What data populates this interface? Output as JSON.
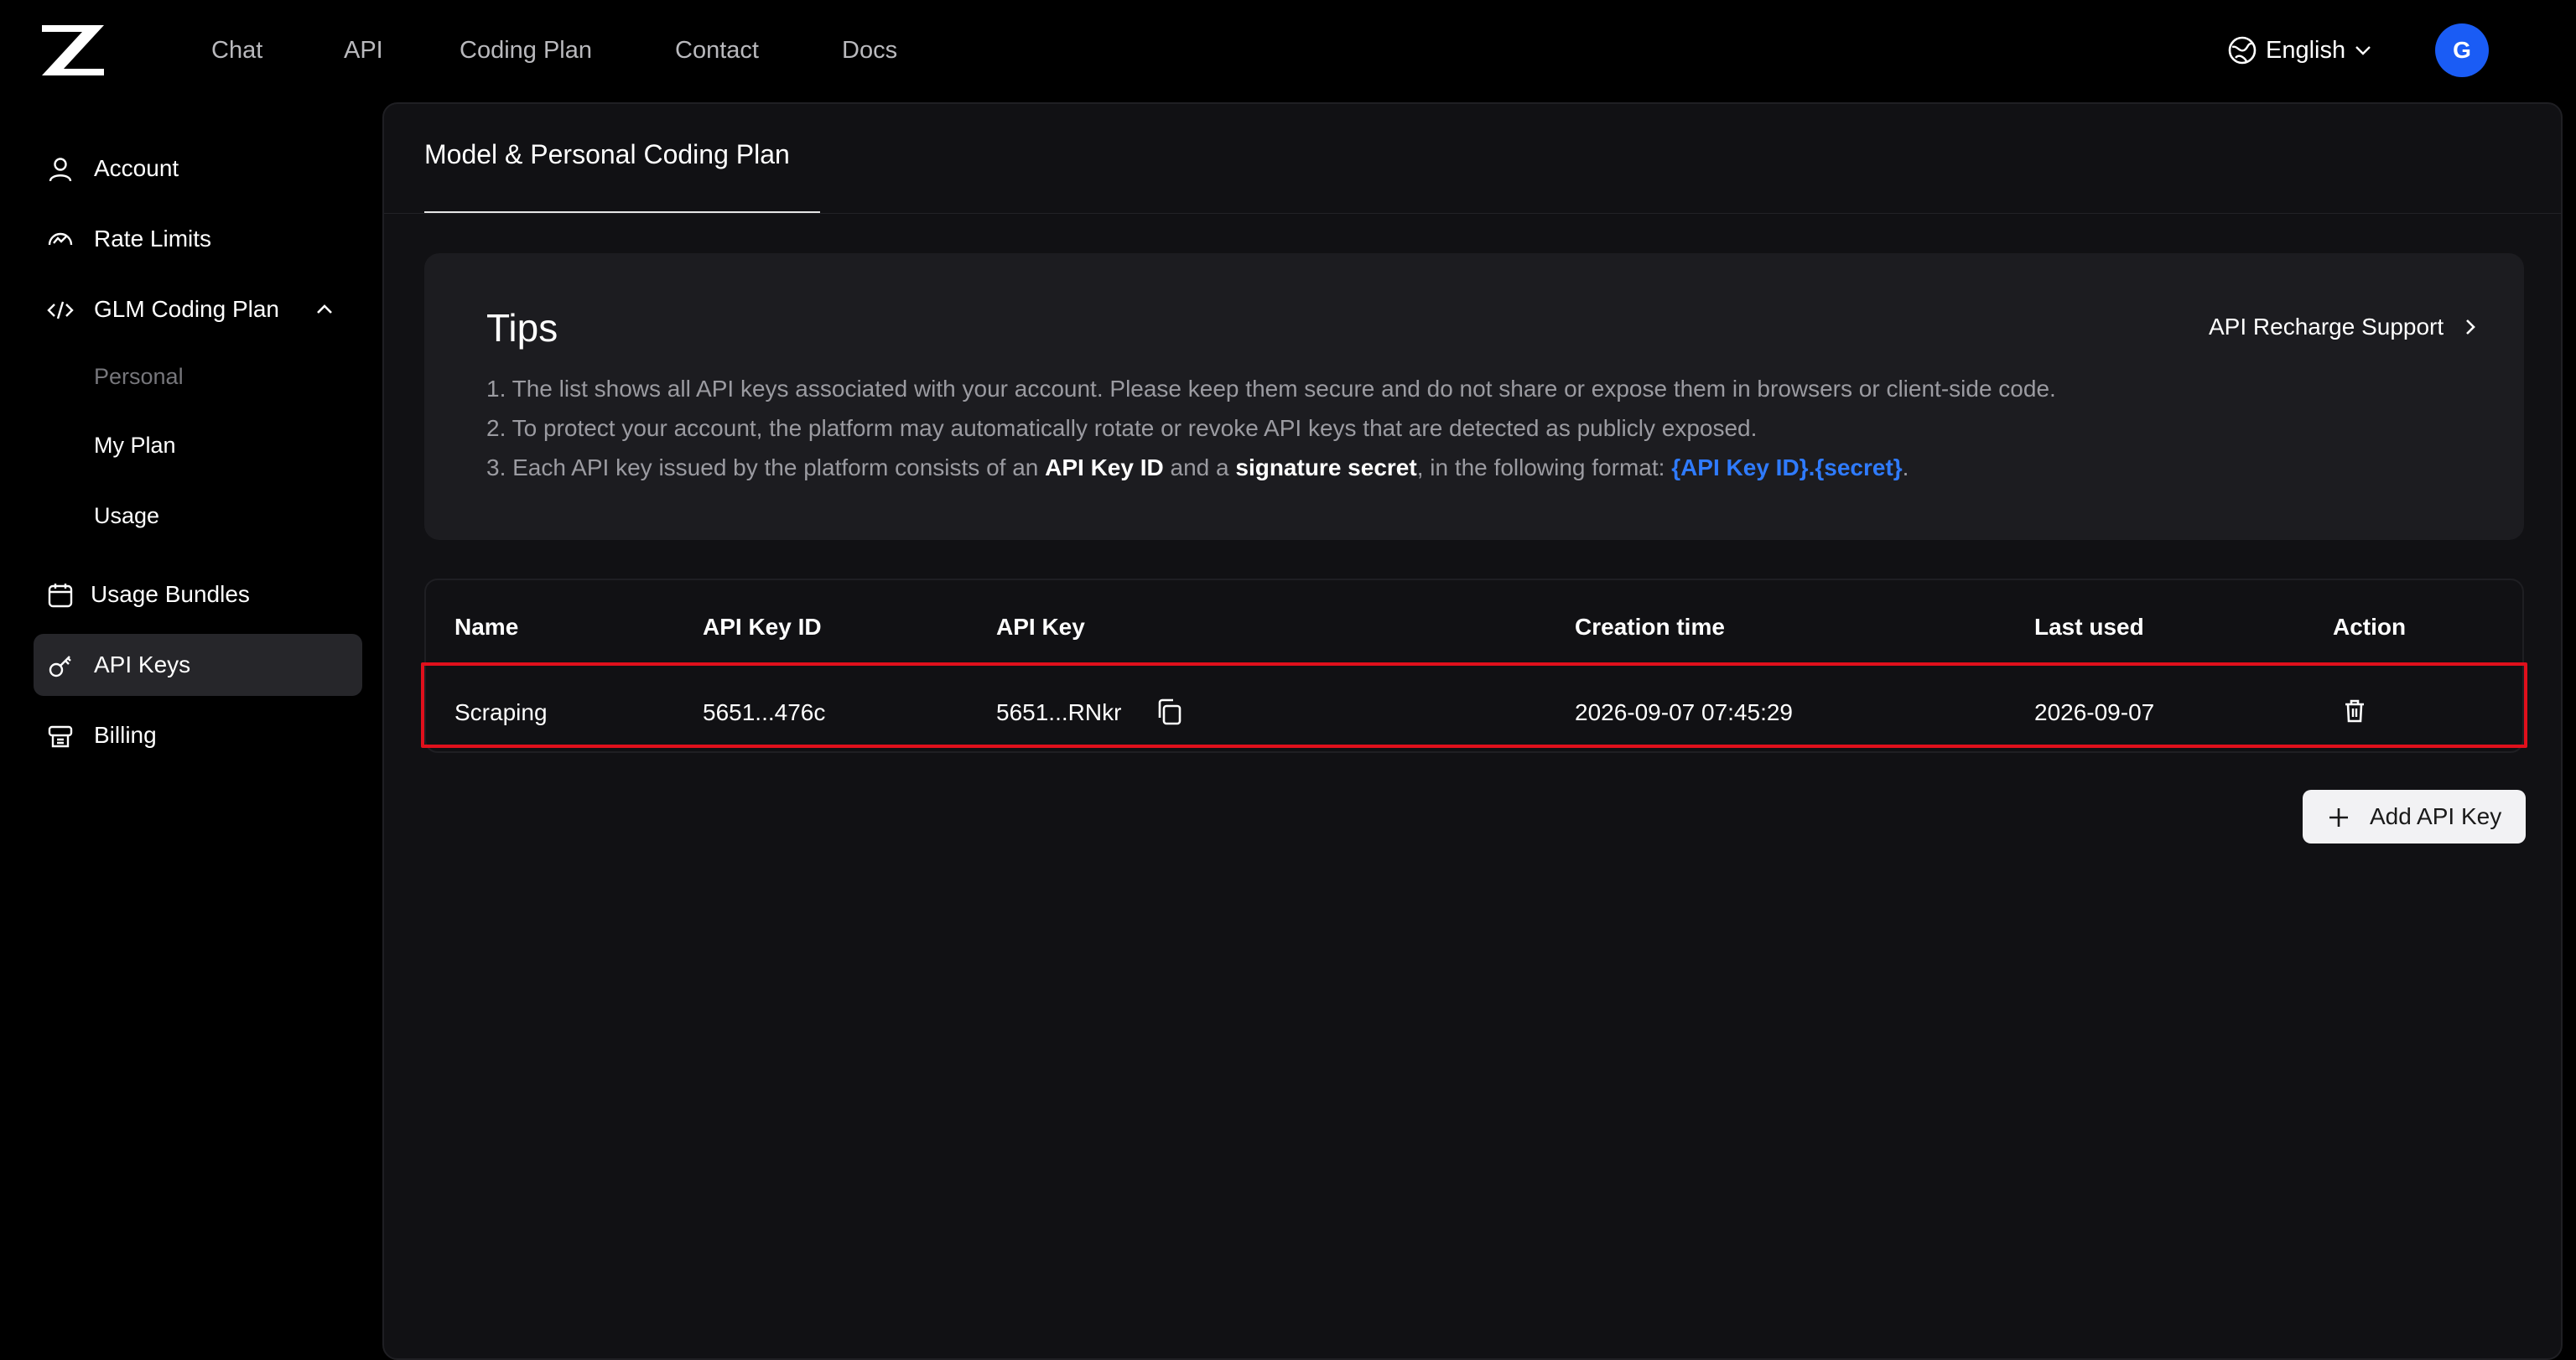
{
  "nav": {
    "links": [
      "Chat",
      "API",
      "Coding Plan",
      "Contact",
      "Docs"
    ],
    "language": "English",
    "avatar_initial": "G"
  },
  "sidebar": {
    "items": [
      {
        "label": "Account",
        "icon": "user-icon"
      },
      {
        "label": "Rate Limits",
        "icon": "gauge-icon"
      },
      {
        "label": "GLM Coding Plan",
        "icon": "code-icon",
        "expanded": true,
        "children": [
          {
            "label": "Personal",
            "muted": true
          },
          {
            "label": "My Plan"
          },
          {
            "label": "Usage"
          }
        ]
      },
      {
        "label": "Usage Bundles",
        "icon": "calendar-icon"
      },
      {
        "label": "API Keys",
        "icon": "key-icon",
        "active": true
      },
      {
        "label": "Billing",
        "icon": "billing-icon"
      }
    ]
  },
  "main": {
    "tab_label": "Model & Personal Coding Plan",
    "tips": {
      "title": "Tips",
      "recharge_label": "API Recharge Support",
      "line1": "1. The list shows all API keys associated with your account. Please keep them secure and do not share or expose them in browsers or client-side code.",
      "line2": "2. To protect your account, the platform may automatically rotate or revoke API keys that are detected as publicly exposed.",
      "line3": {
        "a": "3. Each API key issued by the platform consists of an ",
        "b": "API Key ID",
        "c": " and a ",
        "d": "signature secret",
        "e": ", in the following format: ",
        "f": "{API Key ID}.{secret}",
        "g": "."
      }
    },
    "table": {
      "columns": [
        "Name",
        "API Key ID",
        "API Key",
        "Creation time",
        "Last used",
        "Action"
      ],
      "rows": [
        {
          "name": "Scraping",
          "key_id": "5651...476c",
          "api_key": "5651...RNkr",
          "created": "2026-09-07 07:45:29",
          "last_used": "2026-09-07"
        }
      ]
    },
    "add_button_label": "Add API Key"
  },
  "colors": {
    "accent_blue": "#2f7bff",
    "avatar_blue": "#1a5cf5",
    "highlight_red": "#e0101c"
  }
}
